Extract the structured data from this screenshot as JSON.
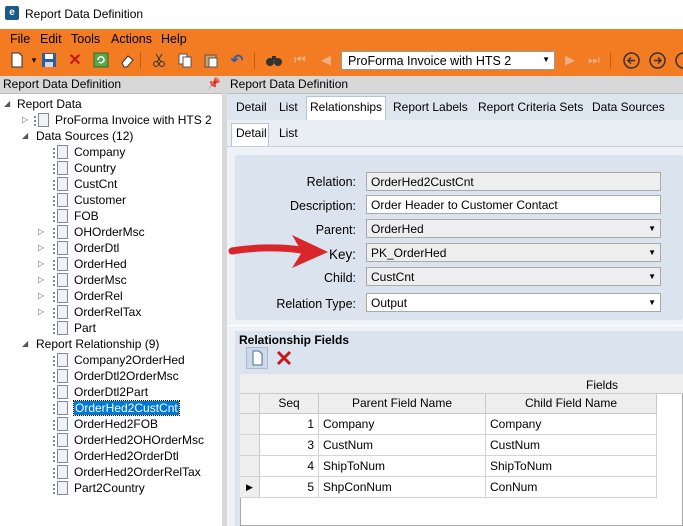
{
  "window": {
    "title": "Report Data Definition"
  },
  "menu": [
    "File",
    "Edit",
    "Tools",
    "Actions",
    "Help"
  ],
  "toolbar": {
    "record_selector": "ProForma Invoice with HTS 2",
    "icons": [
      "new-icon",
      "save-icon",
      "delete-icon",
      "refresh-icon",
      "eraser-icon",
      "cut-icon",
      "copy-icon",
      "paste-icon",
      "undo-icon",
      "search-icon",
      "first-icon",
      "prev-icon",
      "next-icon",
      "last-icon",
      "back-icon",
      "forward-icon"
    ]
  },
  "left_panel": {
    "title": "Report Data Definition",
    "tree": {
      "root": "Report Data",
      "report": "ProForma Invoice with HTS 2",
      "data_sources_label": "Data Sources (12)",
      "data_sources": [
        "Company",
        "Country",
        "CustCnt",
        "Customer",
        "FOB",
        "OHOrderMsc",
        "OrderDtl",
        "OrderHed",
        "OrderMsc",
        "OrderRel",
        "OrderRelTax",
        "Part"
      ],
      "relationships_label": "Report Relationship (9)",
      "relationships": [
        "Company2OrderHed",
        "OrderDtl2OrderMsc",
        "OrderDtl2Part",
        "OrderHed2CustCnt",
        "OrderHed2FOB",
        "OrderHed2OHOrderMsc",
        "OrderHed2OrderDtl",
        "OrderHed2OrderRelTax",
        "Part2Country"
      ],
      "selected": "OrderHed2CustCnt"
    }
  },
  "right_panel": {
    "title": "Report Data Definition",
    "tabs": [
      "Detail",
      "List",
      "Relationships",
      "Report Labels",
      "Report Criteria Sets",
      "Data Sources"
    ],
    "active_tab": "Relationships",
    "subtabs": [
      "Detail",
      "List"
    ],
    "active_subtab": "Detail",
    "form": {
      "relation_label": "Relation:",
      "relation_value": "OrderHed2CustCnt",
      "description_label": "Description:",
      "description_value": "Order Header to Customer Contact",
      "parent_label": "Parent:",
      "parent_value": "OrderHed",
      "key_label": "Key:",
      "key_value": "PK_OrderHed",
      "child_label": "Child:",
      "child_value": "CustCnt",
      "relation_type_label": "Relation Type:",
      "relation_type_value": "Output"
    },
    "grid": {
      "title": "Relationship Fields",
      "group_header": "Fields",
      "columns": [
        "Seq",
        "Parent Field Name",
        "Child Field Name"
      ],
      "rows": [
        {
          "seq": "1",
          "parent": "Company",
          "child": "Company"
        },
        {
          "seq": "3",
          "parent": "CustNum",
          "child": "CustNum"
        },
        {
          "seq": "4",
          "parent": "ShipToNum",
          "child": "ShipToNum"
        },
        {
          "seq": "5",
          "parent": "ShpConNum",
          "child": "ConNum"
        }
      ]
    }
  },
  "colors": {
    "toolbar_orange": "#f37c22",
    "selection_blue": "#0078d7",
    "annotation_arrow": "#d9262b"
  }
}
